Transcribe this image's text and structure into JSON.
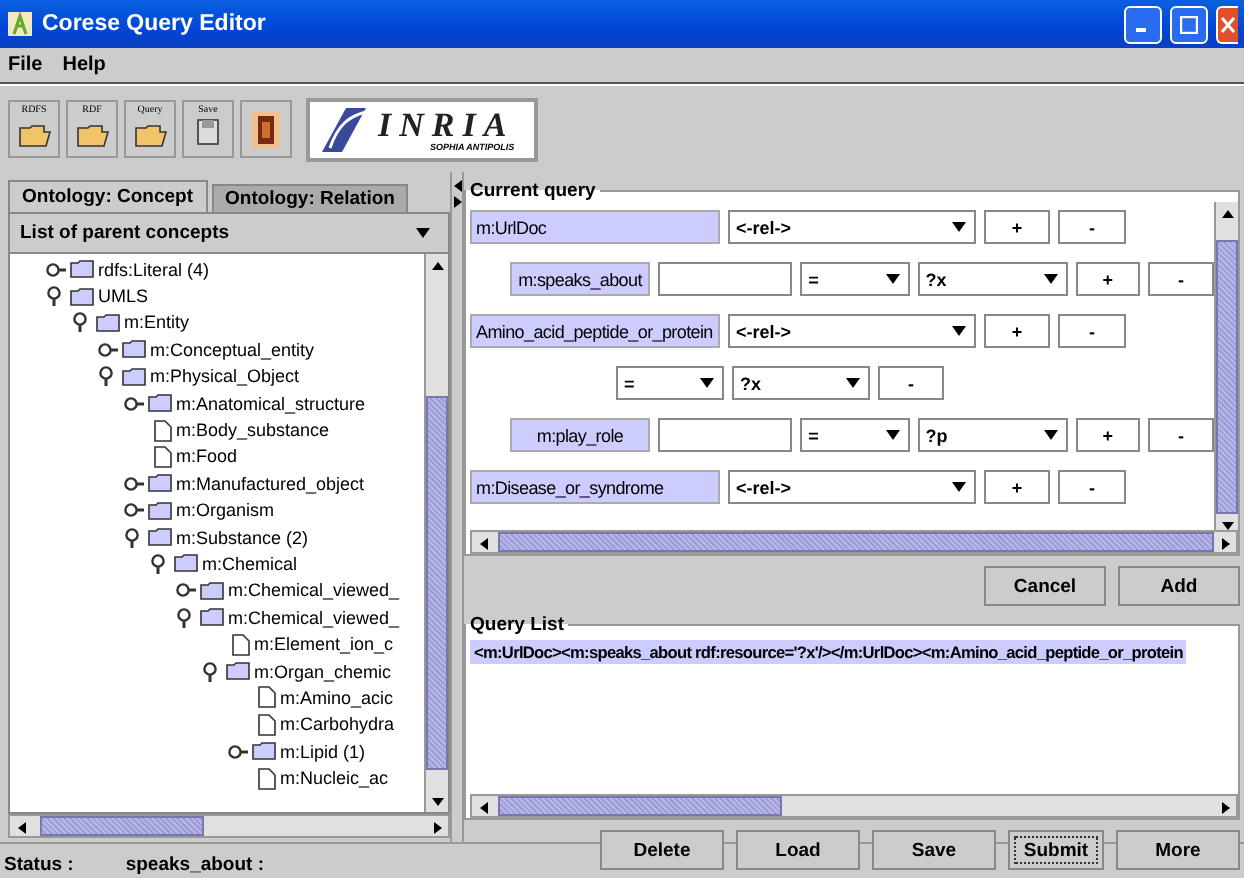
{
  "window": {
    "title": "Corese Query Editor"
  },
  "menu": [
    "File",
    "Help"
  ],
  "toolbar": [
    {
      "label": "RDFS",
      "kind": "open"
    },
    {
      "label": "RDF",
      "kind": "open"
    },
    {
      "label": "Query",
      "kind": "open"
    },
    {
      "label": "Save",
      "kind": "save"
    },
    {
      "kind": "image"
    }
  ],
  "logo": {
    "name": "INRIA",
    "subtitle": "SOPHIA ANTIPOLIS"
  },
  "left_panel": {
    "tabs": [
      {
        "label": "Ontology: Concept",
        "selected": true
      },
      {
        "label": "Ontology: Relation",
        "selected": false
      }
    ],
    "combo": "List of parent concepts",
    "tree": [
      {
        "label": "rdfs:Literal (4)",
        "kind": "folder",
        "expanded": false
      },
      {
        "label": "UMLS",
        "kind": "folder",
        "expanded": true,
        "children": [
          {
            "label": "m:Entity",
            "kind": "folder",
            "expanded": true,
            "children": [
              {
                "label": "m:Conceptual_entity",
                "kind": "folder",
                "expanded": false
              },
              {
                "label": "m:Physical_Object",
                "kind": "folder",
                "expanded": true,
                "children": [
                  {
                    "label": "m:Anatomical_structure",
                    "kind": "folder",
                    "expanded": false
                  },
                  {
                    "label": "m:Body_substance",
                    "kind": "leaf"
                  },
                  {
                    "label": "m:Food",
                    "kind": "leaf"
                  },
                  {
                    "label": "m:Manufactured_object",
                    "kind": "folder",
                    "expanded": false
                  },
                  {
                    "label": "m:Organism",
                    "kind": "folder",
                    "expanded": false
                  },
                  {
                    "label": "m:Substance (2)",
                    "kind": "folder",
                    "expanded": true,
                    "children": [
                      {
                        "label": "m:Chemical",
                        "kind": "folder",
                        "expanded": true,
                        "children": [
                          {
                            "label": "m:Chemical_viewed_",
                            "kind": "folder",
                            "expanded": false
                          },
                          {
                            "label": "m:Chemical_viewed_",
                            "kind": "folder",
                            "expanded": true,
                            "children": [
                              {
                                "label": "m:Element_ion_c",
                                "kind": "leaf"
                              },
                              {
                                "label": "m:Organ_chemic",
                                "kind": "folder",
                                "expanded": true,
                                "children": [
                                  {
                                    "label": "m:Amino_acic",
                                    "kind": "leaf"
                                  },
                                  {
                                    "label": "m:Carbohydra",
                                    "kind": "leaf"
                                  },
                                  {
                                    "label": "m:Lipid (1)",
                                    "kind": "folder",
                                    "expanded": false
                                  },
                                  {
                                    "label": "m:Nucleic_ac",
                                    "kind": "leaf"
                                  }
                                ]
                              }
                            ]
                          }
                        ]
                      }
                    ]
                  }
                ]
              }
            ]
          }
        ]
      }
    ]
  },
  "current_query": {
    "title": "Current query",
    "rows": [
      {
        "kind": "node",
        "concept": "m:UrlDoc",
        "relation": "<-rel->",
        "add": "+",
        "remove": "-"
      },
      {
        "kind": "relation",
        "property": "m:speaks_about",
        "operator": "=",
        "variable": "?x",
        "add": "+",
        "remove": "-"
      },
      {
        "kind": "node",
        "concept": "Amino_acid_peptide_or_protein",
        "relation": "<-rel->",
        "add": "+",
        "remove": "-"
      },
      {
        "kind": "filter",
        "operator": "=",
        "variable": "?x",
        "remove": "-"
      },
      {
        "kind": "relation",
        "property": "m:play_role",
        "operator": "=",
        "variable": "?p",
        "add": "+",
        "remove": "-"
      },
      {
        "kind": "node",
        "concept": "m:Disease_or_syndrome",
        "relation": "<-rel->",
        "add": "+",
        "remove": "-"
      }
    ]
  },
  "query_buttons": [
    "Cancel",
    "Add"
  ],
  "query_list": {
    "title": "Query List",
    "items": [
      {
        "text": "<m:UrlDoc><m:speaks_about rdf:resource='?x'/></m:UrlDoc><m:Amino_acid_peptide_or_protein",
        "selected": true
      }
    ]
  },
  "list_buttons": [
    {
      "label": "Delete",
      "focused": false
    },
    {
      "label": "Load",
      "focused": false
    },
    {
      "label": "Save",
      "focused": false
    },
    {
      "label": "Submit",
      "focused": true
    },
    {
      "label": "More",
      "focused": false
    }
  ],
  "status_bar": {
    "label": "Status :",
    "value": "speaks_about :"
  }
}
